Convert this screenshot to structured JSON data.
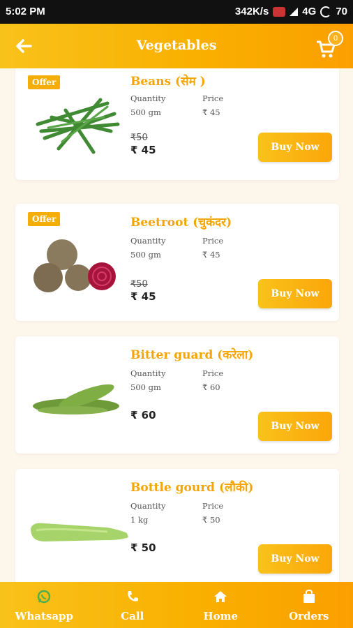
{
  "status": {
    "time": "5:02 PM",
    "speed": "342K/s",
    "network": "4G",
    "battery": "70"
  },
  "header": {
    "title": "Vegetables",
    "cart_count": "0"
  },
  "labels": {
    "quantity": "Quantity",
    "price": "Price",
    "offer": "Offer",
    "buy": "Buy Now"
  },
  "products": [
    {
      "name": "Beans (सेम )",
      "quantity": "500 gm",
      "price": "₹ 45",
      "old_price": "₹50",
      "final_price": "₹ 45",
      "offer": true
    },
    {
      "name": "Beetroot (चुकंदर)",
      "quantity": "500 gm",
      "price": "₹ 45",
      "old_price": "₹50",
      "final_price": "₹ 45",
      "offer": true
    },
    {
      "name": "Bitter guard (करेला)",
      "quantity": "500 gm",
      "price": "₹ 60",
      "old_price": "",
      "final_price": "₹ 60",
      "offer": false
    },
    {
      "name": "Bottle gourd (लौकी)",
      "quantity": "1 kg",
      "price": "₹ 50",
      "old_price": "",
      "final_price": "₹ 50",
      "offer": false
    }
  ],
  "nav": [
    {
      "label": "Whatsapp",
      "icon": "whatsapp-icon"
    },
    {
      "label": "Call",
      "icon": "phone-icon"
    },
    {
      "label": "Home",
      "icon": "home-icon"
    },
    {
      "label": "Orders",
      "icon": "bag-icon"
    }
  ],
  "colors": {
    "accent": "#f9b000",
    "title": "#f5a500",
    "whatsapp": "#4caf50"
  }
}
